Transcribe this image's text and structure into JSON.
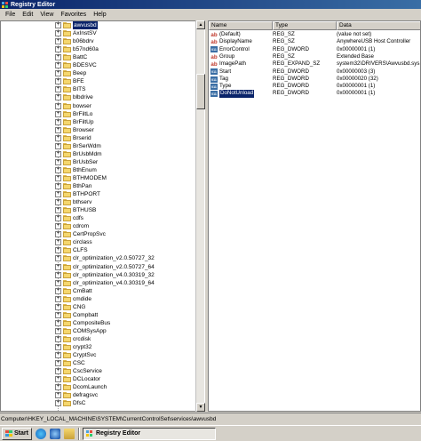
{
  "window": {
    "title": "Registry Editor"
  },
  "menu": [
    "File",
    "Edit",
    "View",
    "Favorites",
    "Help"
  ],
  "tree": {
    "items": [
      {
        "label": "awvusbd",
        "selected": true
      },
      {
        "label": "AxInstSV",
        "selected": false
      },
      {
        "label": "b06bdrv",
        "selected": false
      },
      {
        "label": "b57nd60a",
        "selected": false
      },
      {
        "label": "BattC",
        "selected": false
      },
      {
        "label": "BDESVC",
        "selected": false
      },
      {
        "label": "Beep",
        "selected": false
      },
      {
        "label": "BFE",
        "selected": false
      },
      {
        "label": "BITS",
        "selected": false
      },
      {
        "label": "blbdrive",
        "selected": false
      },
      {
        "label": "bowser",
        "selected": false
      },
      {
        "label": "BrFiltLo",
        "selected": false
      },
      {
        "label": "BrFiltUp",
        "selected": false
      },
      {
        "label": "Browser",
        "selected": false
      },
      {
        "label": "Brserid",
        "selected": false
      },
      {
        "label": "BrSerWdm",
        "selected": false
      },
      {
        "label": "BrUsbMdm",
        "selected": false
      },
      {
        "label": "BrUsbSer",
        "selected": false
      },
      {
        "label": "BthEnum",
        "selected": false
      },
      {
        "label": "BTHMODEM",
        "selected": false
      },
      {
        "label": "BthPan",
        "selected": false
      },
      {
        "label": "BTHPORT",
        "selected": false
      },
      {
        "label": "bthserv",
        "selected": false
      },
      {
        "label": "BTHUSB",
        "selected": false
      },
      {
        "label": "cdfs",
        "selected": false
      },
      {
        "label": "cdrom",
        "selected": false
      },
      {
        "label": "CertPropSvc",
        "selected": false
      },
      {
        "label": "circlass",
        "selected": false
      },
      {
        "label": "CLFS",
        "selected": false
      },
      {
        "label": "clr_optimization_v2.0.50727_32",
        "selected": false
      },
      {
        "label": "clr_optimization_v2.0.50727_64",
        "selected": false
      },
      {
        "label": "clr_optimization_v4.0.30319_32",
        "selected": false
      },
      {
        "label": "clr_optimization_v4.0.30319_64",
        "selected": false
      },
      {
        "label": "CmBatt",
        "selected": false
      },
      {
        "label": "cmdide",
        "selected": false
      },
      {
        "label": "CNG",
        "selected": false
      },
      {
        "label": "Compbatt",
        "selected": false
      },
      {
        "label": "CompositeBus",
        "selected": false
      },
      {
        "label": "COMSysApp",
        "selected": false
      },
      {
        "label": "crcdisk",
        "selected": false
      },
      {
        "label": "crypt32",
        "selected": false
      },
      {
        "label": "CryptSvc",
        "selected": false
      },
      {
        "label": "CSC",
        "selected": false
      },
      {
        "label": "CscService",
        "selected": false
      },
      {
        "label": "DCLocator",
        "selected": false
      },
      {
        "label": "DcomLaunch",
        "selected": false
      },
      {
        "label": "defragsvc",
        "selected": false
      },
      {
        "label": "DfsC",
        "selected": false
      }
    ]
  },
  "values": {
    "columns": [
      "Name",
      "Type",
      "Data"
    ],
    "rows": [
      {
        "name": "(Default)",
        "type": "REG_SZ",
        "data": "(value not set)",
        "icon": "string-value-icon"
      },
      {
        "name": "DisplayName",
        "type": "REG_SZ",
        "data": "AnywhereUSB Host Controller",
        "icon": "string-value-icon"
      },
      {
        "name": "ErrorControl",
        "type": "REG_DWORD",
        "data": "0x00000001 (1)",
        "icon": "binary-value-icon"
      },
      {
        "name": "Group",
        "type": "REG_SZ",
        "data": "Extended Base",
        "icon": "string-value-icon"
      },
      {
        "name": "ImagePath",
        "type": "REG_EXPAND_SZ",
        "data": "system32\\DRIVERS\\Awvusbd.sys",
        "icon": "string-value-icon"
      },
      {
        "name": "Start",
        "type": "REG_DWORD",
        "data": "0x00000003 (3)",
        "icon": "binary-value-icon"
      },
      {
        "name": "Tag",
        "type": "REG_DWORD",
        "data": "0x00000020 (32)",
        "icon": "binary-value-icon"
      },
      {
        "name": "Type",
        "type": "REG_DWORD",
        "data": "0x00000001 (1)",
        "icon": "binary-value-icon"
      },
      {
        "name": "DoNotUnload",
        "type": "REG_DWORD",
        "data": "0x00000001 (1)",
        "icon": "binary-value-icon",
        "selected": true
      }
    ]
  },
  "status": {
    "path": "Computer\\HKEY_LOCAL_MACHINE\\SYSTEM\\CurrentControlSet\\services\\awvusbd"
  },
  "taskbar": {
    "start_label": "Start",
    "task_label": "Registry Editor"
  }
}
